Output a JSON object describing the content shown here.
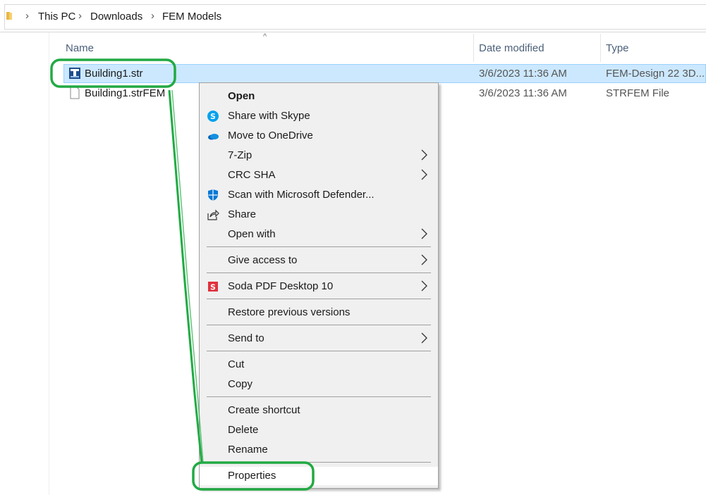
{
  "address_bar": {
    "crumbs": [
      "This PC",
      "Downloads",
      "FEM Models"
    ]
  },
  "columns": {
    "name": "Name",
    "date_modified": "Date modified",
    "type": "Type"
  },
  "files": [
    {
      "name": "Building1.str",
      "date": "3/6/2023 11:36 AM",
      "type": "FEM-Design 22 3D...",
      "icon": "fem-design-icon",
      "selected": true
    },
    {
      "name": "Building1.strFEM",
      "date": "3/6/2023 11:36 AM",
      "type": "STRFEM File",
      "icon": "blank-file-icon",
      "selected": false
    }
  ],
  "context_menu": {
    "open": "Open",
    "share_skype": "Share with Skype",
    "move_onedrive": "Move to OneDrive",
    "seven_zip": "7-Zip",
    "crc_sha": "CRC SHA",
    "scan_defender": "Scan with Microsoft Defender...",
    "share": "Share",
    "open_with": "Open with",
    "give_access": "Give access to",
    "soda_pdf": "Soda PDF Desktop 10",
    "restore_versions": "Restore previous versions",
    "send_to": "Send to",
    "cut": "Cut",
    "copy": "Copy",
    "create_shortcut": "Create shortcut",
    "delete": "Delete",
    "rename": "Rename",
    "properties": "Properties"
  },
  "colors": {
    "selection_bg": "#cce8ff",
    "annotation_green": "#22aa44",
    "menu_bg": "#f0f0f0"
  }
}
